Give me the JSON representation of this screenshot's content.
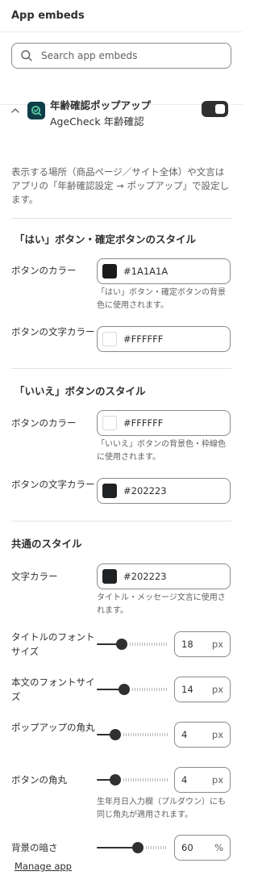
{
  "header": {
    "title": "App embeds"
  },
  "search": {
    "placeholder": "Search app embeds"
  },
  "app": {
    "name": "年齢確認ポップアップ",
    "subtitle": "AgeCheck 年齢確認",
    "enabled": true,
    "description": "表示する場所（商品ページ／サイト全体）や文言はアプリの「年齢確認設定 → ポップアップ」で設定します。"
  },
  "sections": {
    "yes": {
      "title": "「はい」ボタン・確定ボタンのスタイル",
      "button_color": {
        "label": "ボタンのカラー",
        "value": "#1A1A1A",
        "help": "「はい」ボタン・確定ボタンの背景色に使用されます。"
      },
      "text_color": {
        "label": "ボタンの文字カラー",
        "value": "#FFFFFF"
      }
    },
    "no": {
      "title": "「いいえ」ボタンのスタイル",
      "button_color": {
        "label": "ボタンのカラー",
        "value": "#FFFFFF",
        "help": "「いいえ」ボタンの背景色・枠線色に使用されます。"
      },
      "text_color": {
        "label": "ボタンの文字カラー",
        "value": "#202223"
      }
    },
    "common": {
      "title": "共通のスタイル",
      "text_color": {
        "label": "文字カラー",
        "value": "#202223",
        "help": "タイトル・メッセージ文言に使用されます。"
      },
      "title_font_size": {
        "label": "タイトルのフォントサイズ",
        "value": "18",
        "unit": "px",
        "fraction": 0.33
      },
      "body_font_size": {
        "label": "本文のフォントサイズ",
        "value": "14",
        "unit": "px",
        "fraction": 0.36
      },
      "popup_radius": {
        "label": "ポップアップの角丸",
        "value": "4",
        "unit": "px",
        "fraction": 0.22
      },
      "button_radius": {
        "label": "ボタンの角丸",
        "value": "4",
        "unit": "px",
        "fraction": 0.22,
        "help": "生年月日入力欄（プルダウン）にも同じ角丸が適用されます。"
      },
      "bg_darkness": {
        "label": "背景の暗さ",
        "value": "60",
        "unit": "%",
        "fraction": 0.6
      }
    }
  },
  "footer": {
    "manage_label": "Manage app"
  }
}
